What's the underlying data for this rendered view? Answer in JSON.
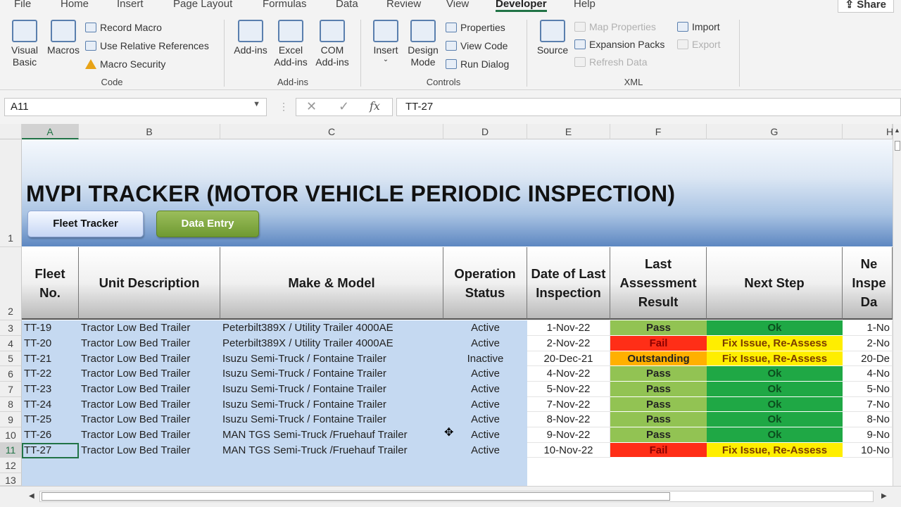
{
  "ribbon_tabs": [
    "File",
    "Home",
    "Insert",
    "Page Layout",
    "Formulas",
    "Data",
    "Review",
    "View",
    "Developer",
    "Help"
  ],
  "active_tab": "Developer",
  "share_label": "Share",
  "ribbon": {
    "code": {
      "label": "Code",
      "visual_basic": "Visual Basic",
      "macros": "Macros",
      "record_macro": "Record Macro",
      "relative_refs": "Use Relative References",
      "macro_security": "Macro Security"
    },
    "addins": {
      "label": "Add-ins",
      "addins": "Add-ins",
      "excel_addins": "Excel Add-ins",
      "com_addins": "COM Add-ins"
    },
    "controls": {
      "label": "Controls",
      "insert": "Insert",
      "design_mode": "Design Mode",
      "properties": "Properties",
      "view_code": "View Code",
      "run_dialog": "Run Dialog"
    },
    "xml": {
      "label": "XML",
      "source": "Source",
      "map_properties": "Map Properties",
      "expansion_packs": "Expansion Packs",
      "refresh_data": "Refresh Data",
      "import": "Import",
      "export": "Export"
    }
  },
  "formula_bar": {
    "name_box": "A11",
    "formula": "TT-27"
  },
  "column_letters": [
    "A",
    "B",
    "C",
    "D",
    "E",
    "F",
    "G",
    "H"
  ],
  "row_numbers": [
    "1",
    "2",
    "3",
    "4",
    "5",
    "6",
    "7",
    "8",
    "9",
    "10",
    "11",
    "12",
    "13"
  ],
  "sheet": {
    "title": "MVPI TRACKER (MOTOR VEHICLE PERIODIC INSPECTION)",
    "fleet_tracker_button": "Fleet Tracker",
    "data_entry_button": "Data Entry",
    "headers": [
      "Fleet No.",
      "Unit Description",
      "Make & Model",
      "Operation Status",
      "Date of Last Inspection",
      "Last Assessment Result",
      "Next Step",
      "Ne Inspe Da"
    ],
    "rows": [
      {
        "fleet": "TT-19",
        "unit": "Tractor Low Bed Trailer",
        "make": "Peterbilt389X / Utility Trailer 4000AE",
        "status": "Active",
        "date": "1-Nov-22",
        "result": "Pass",
        "next": "Ok",
        "next_date": "1-No"
      },
      {
        "fleet": "TT-20",
        "unit": "Tractor Low Bed Trailer",
        "make": "Peterbilt389X / Utility Trailer 4000AE",
        "status": "Active",
        "date": "2-Nov-22",
        "result": "Fail",
        "next": "Fix Issue, Re-Assess",
        "next_date": "2-No"
      },
      {
        "fleet": "TT-21",
        "unit": "Tractor Low Bed Trailer",
        "make": "Isuzu Semi-Truck / Fontaine Trailer",
        "status": "Inactive",
        "date": "20-Dec-21",
        "result": "Outstanding",
        "next": "Fix Issue, Re-Assess",
        "next_date": "20-De"
      },
      {
        "fleet": "TT-22",
        "unit": "Tractor Low Bed Trailer",
        "make": "Isuzu Semi-Truck / Fontaine Trailer",
        "status": "Active",
        "date": "4-Nov-22",
        "result": "Pass",
        "next": "Ok",
        "next_date": "4-No"
      },
      {
        "fleet": "TT-23",
        "unit": "Tractor Low Bed Trailer",
        "make": "Isuzu Semi-Truck / Fontaine Trailer",
        "status": "Active",
        "date": "5-Nov-22",
        "result": "Pass",
        "next": "Ok",
        "next_date": "5-No"
      },
      {
        "fleet": "TT-24",
        "unit": "Tractor Low Bed Trailer",
        "make": "Isuzu Semi-Truck / Fontaine Trailer",
        "status": "Active",
        "date": "7-Nov-22",
        "result": "Pass",
        "next": "Ok",
        "next_date": "7-No"
      },
      {
        "fleet": "TT-25",
        "unit": "Tractor Low Bed Trailer",
        "make": "Isuzu Semi-Truck / Fontaine Trailer",
        "status": "Active",
        "date": "8-Nov-22",
        "result": "Pass",
        "next": "Ok",
        "next_date": "8-No"
      },
      {
        "fleet": "TT-26",
        "unit": "Tractor Low Bed Trailer",
        "make": "MAN TGS Semi-Truck /Fruehauf Trailer",
        "status": "Active",
        "date": "9-Nov-22",
        "result": "Pass",
        "next": "Ok",
        "next_date": "9-No"
      },
      {
        "fleet": "TT-27",
        "unit": "Tractor Low Bed Trailer",
        "make": "MAN TGS Semi-Truck /Fruehauf Trailer",
        "status": "Active",
        "date": "10-Nov-22",
        "result": "Fail",
        "next": "Fix Issue, Re-Assess",
        "next_date": "10-No"
      }
    ]
  },
  "colors": {
    "excel_green": "#217346",
    "data_fill": "#c5d9f1",
    "pass_fill": "#92c353",
    "fail_fill": "#ff2e17",
    "outstanding_fill": "#ffb000",
    "ok_fill": "#1fa845",
    "fix_fill": "#ffee00"
  }
}
